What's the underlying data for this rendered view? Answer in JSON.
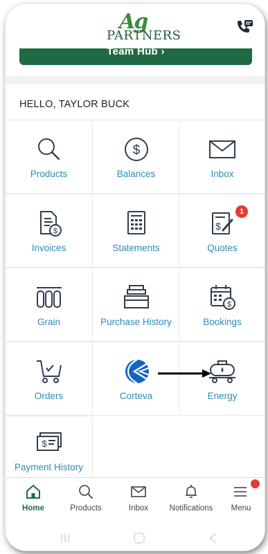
{
  "header": {
    "logo_ag": "Ag",
    "logo_partners": "PARTNERS",
    "team_hub_label": "Team Hub  ›"
  },
  "greeting": "HELLO, TAYLOR BUCK",
  "tiles": [
    {
      "label": "Products",
      "icon": "search-icon"
    },
    {
      "label": "Balances",
      "icon": "dollar-circle-icon"
    },
    {
      "label": "Inbox",
      "icon": "envelope-icon"
    },
    {
      "label": "Invoices",
      "icon": "invoice-icon"
    },
    {
      "label": "Statements",
      "icon": "statement-icon"
    },
    {
      "label": "Quotes",
      "icon": "quote-icon",
      "badge": "1"
    },
    {
      "label": "Grain",
      "icon": "grain-bins-icon"
    },
    {
      "label": "Purchase History",
      "icon": "file-box-icon"
    },
    {
      "label": "Bookings",
      "icon": "calendar-dollar-icon"
    },
    {
      "label": "Orders",
      "icon": "cart-icon"
    },
    {
      "label": "Corteva",
      "icon": "corteva-logo-icon"
    },
    {
      "label": "Energy",
      "icon": "tanker-truck-icon"
    },
    {
      "label": "Payment History",
      "icon": "cash-icon"
    }
  ],
  "bottom_nav": [
    {
      "label": "Home",
      "icon": "home-icon",
      "active": true
    },
    {
      "label": "Products",
      "icon": "search-icon"
    },
    {
      "label": "Inbox",
      "icon": "envelope-icon"
    },
    {
      "label": "Notifications",
      "icon": "bell-icon"
    },
    {
      "label": "Menu",
      "icon": "hamburger-icon"
    }
  ],
  "colors": {
    "brand_green": "#1f6a45",
    "link_blue": "#2d8bba",
    "icon_dark": "#2f3e4e",
    "badge_red": "#e53935",
    "corteva_blue": "#1565c0"
  }
}
